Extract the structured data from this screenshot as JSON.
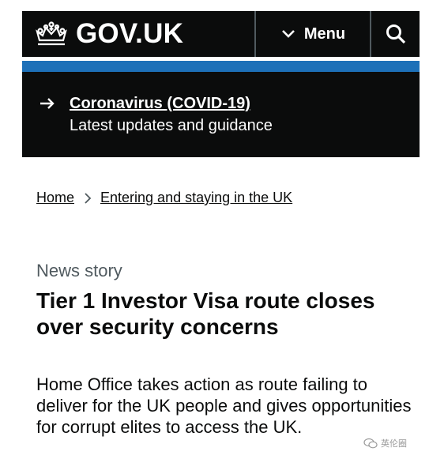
{
  "header": {
    "logo_text": "GOV.UK",
    "menu_label": "Menu",
    "colors": {
      "background": "#0b0c0c",
      "accent_bar": "#1d70b8"
    },
    "icons": [
      "crown-icon",
      "chevron-down-icon",
      "search-icon"
    ]
  },
  "banner": {
    "link": "Coronavirus (COVID-19)",
    "subtitle": "Latest updates and guidance",
    "icon": "arrow-right-icon"
  },
  "breadcrumb": {
    "items": [
      "Home",
      "Entering and staying in the UK"
    ],
    "separator_icon": "chevron-right-icon"
  },
  "article": {
    "type": "News story",
    "title": "Tier 1 Investor Visa route closes over security concerns",
    "summary": "Home Office takes action as route failing to deliver for the UK people and gives opportunities for corrupt elites to access the UK."
  },
  "watermark": {
    "text": "英伦圈",
    "icon": "chat-bubble-icon"
  }
}
